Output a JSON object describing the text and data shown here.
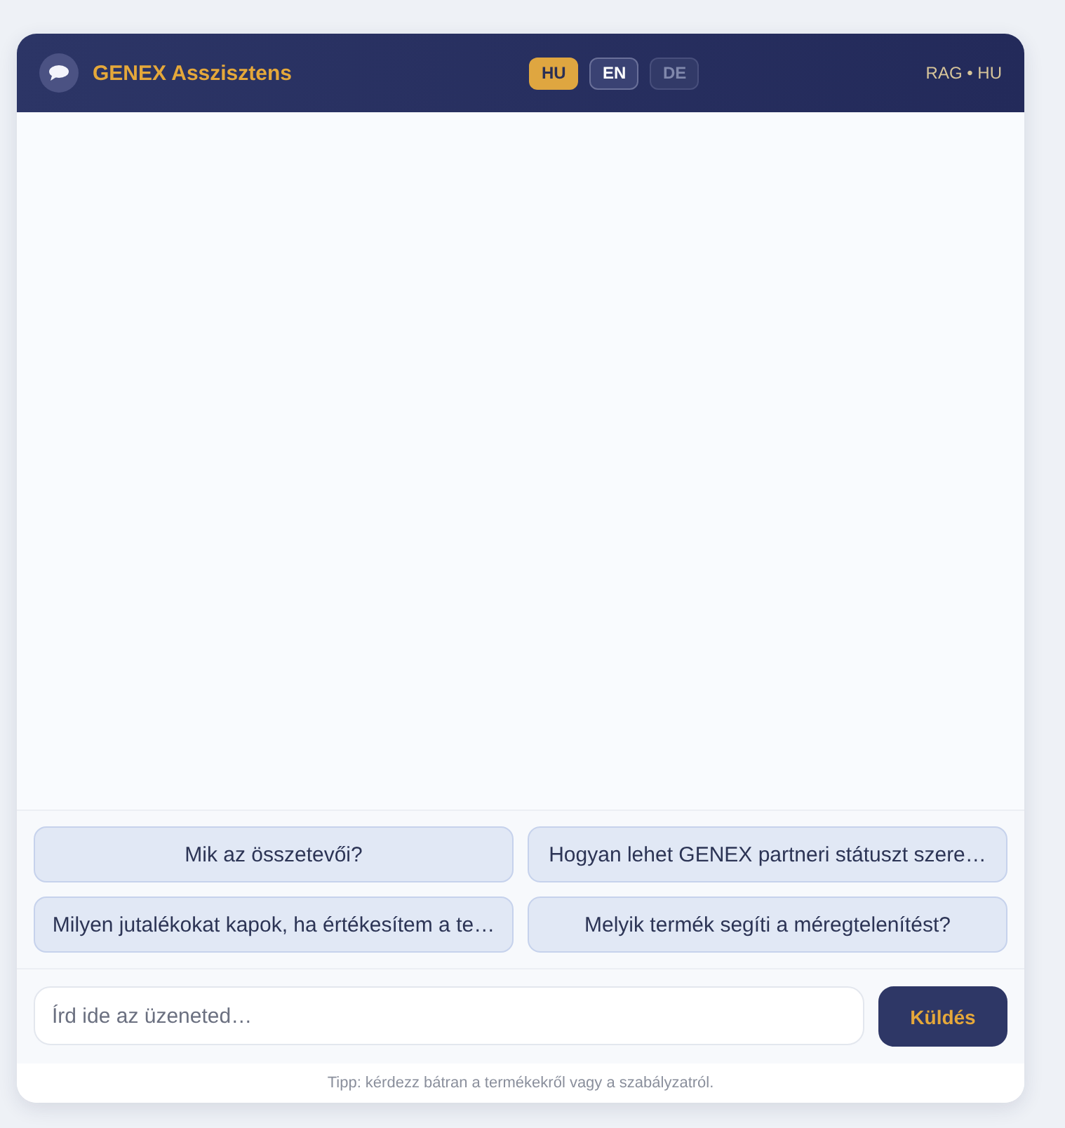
{
  "header": {
    "title": "GENEX Asszisztens",
    "status": "RAG • HU"
  },
  "languages": [
    {
      "label": "HU",
      "selected": true,
      "disabled": false
    },
    {
      "label": "EN",
      "selected": false,
      "disabled": false
    },
    {
      "label": "DE",
      "selected": false,
      "disabled": true
    }
  ],
  "suggestions": [
    "Mik az összetevői?",
    "Hogyan lehet GENEX partneri státuszt szere…",
    "Milyen jutalékokat kapok, ha értékesítem a te…",
    "Melyik termék segíti a méregtelenítést?"
  ],
  "composer": {
    "placeholder": "Írd ide az üzeneted…",
    "send_label": "Küldés"
  },
  "tip": "Tipp: kérdezz bátran a termékekről vagy a szabályzatról."
}
